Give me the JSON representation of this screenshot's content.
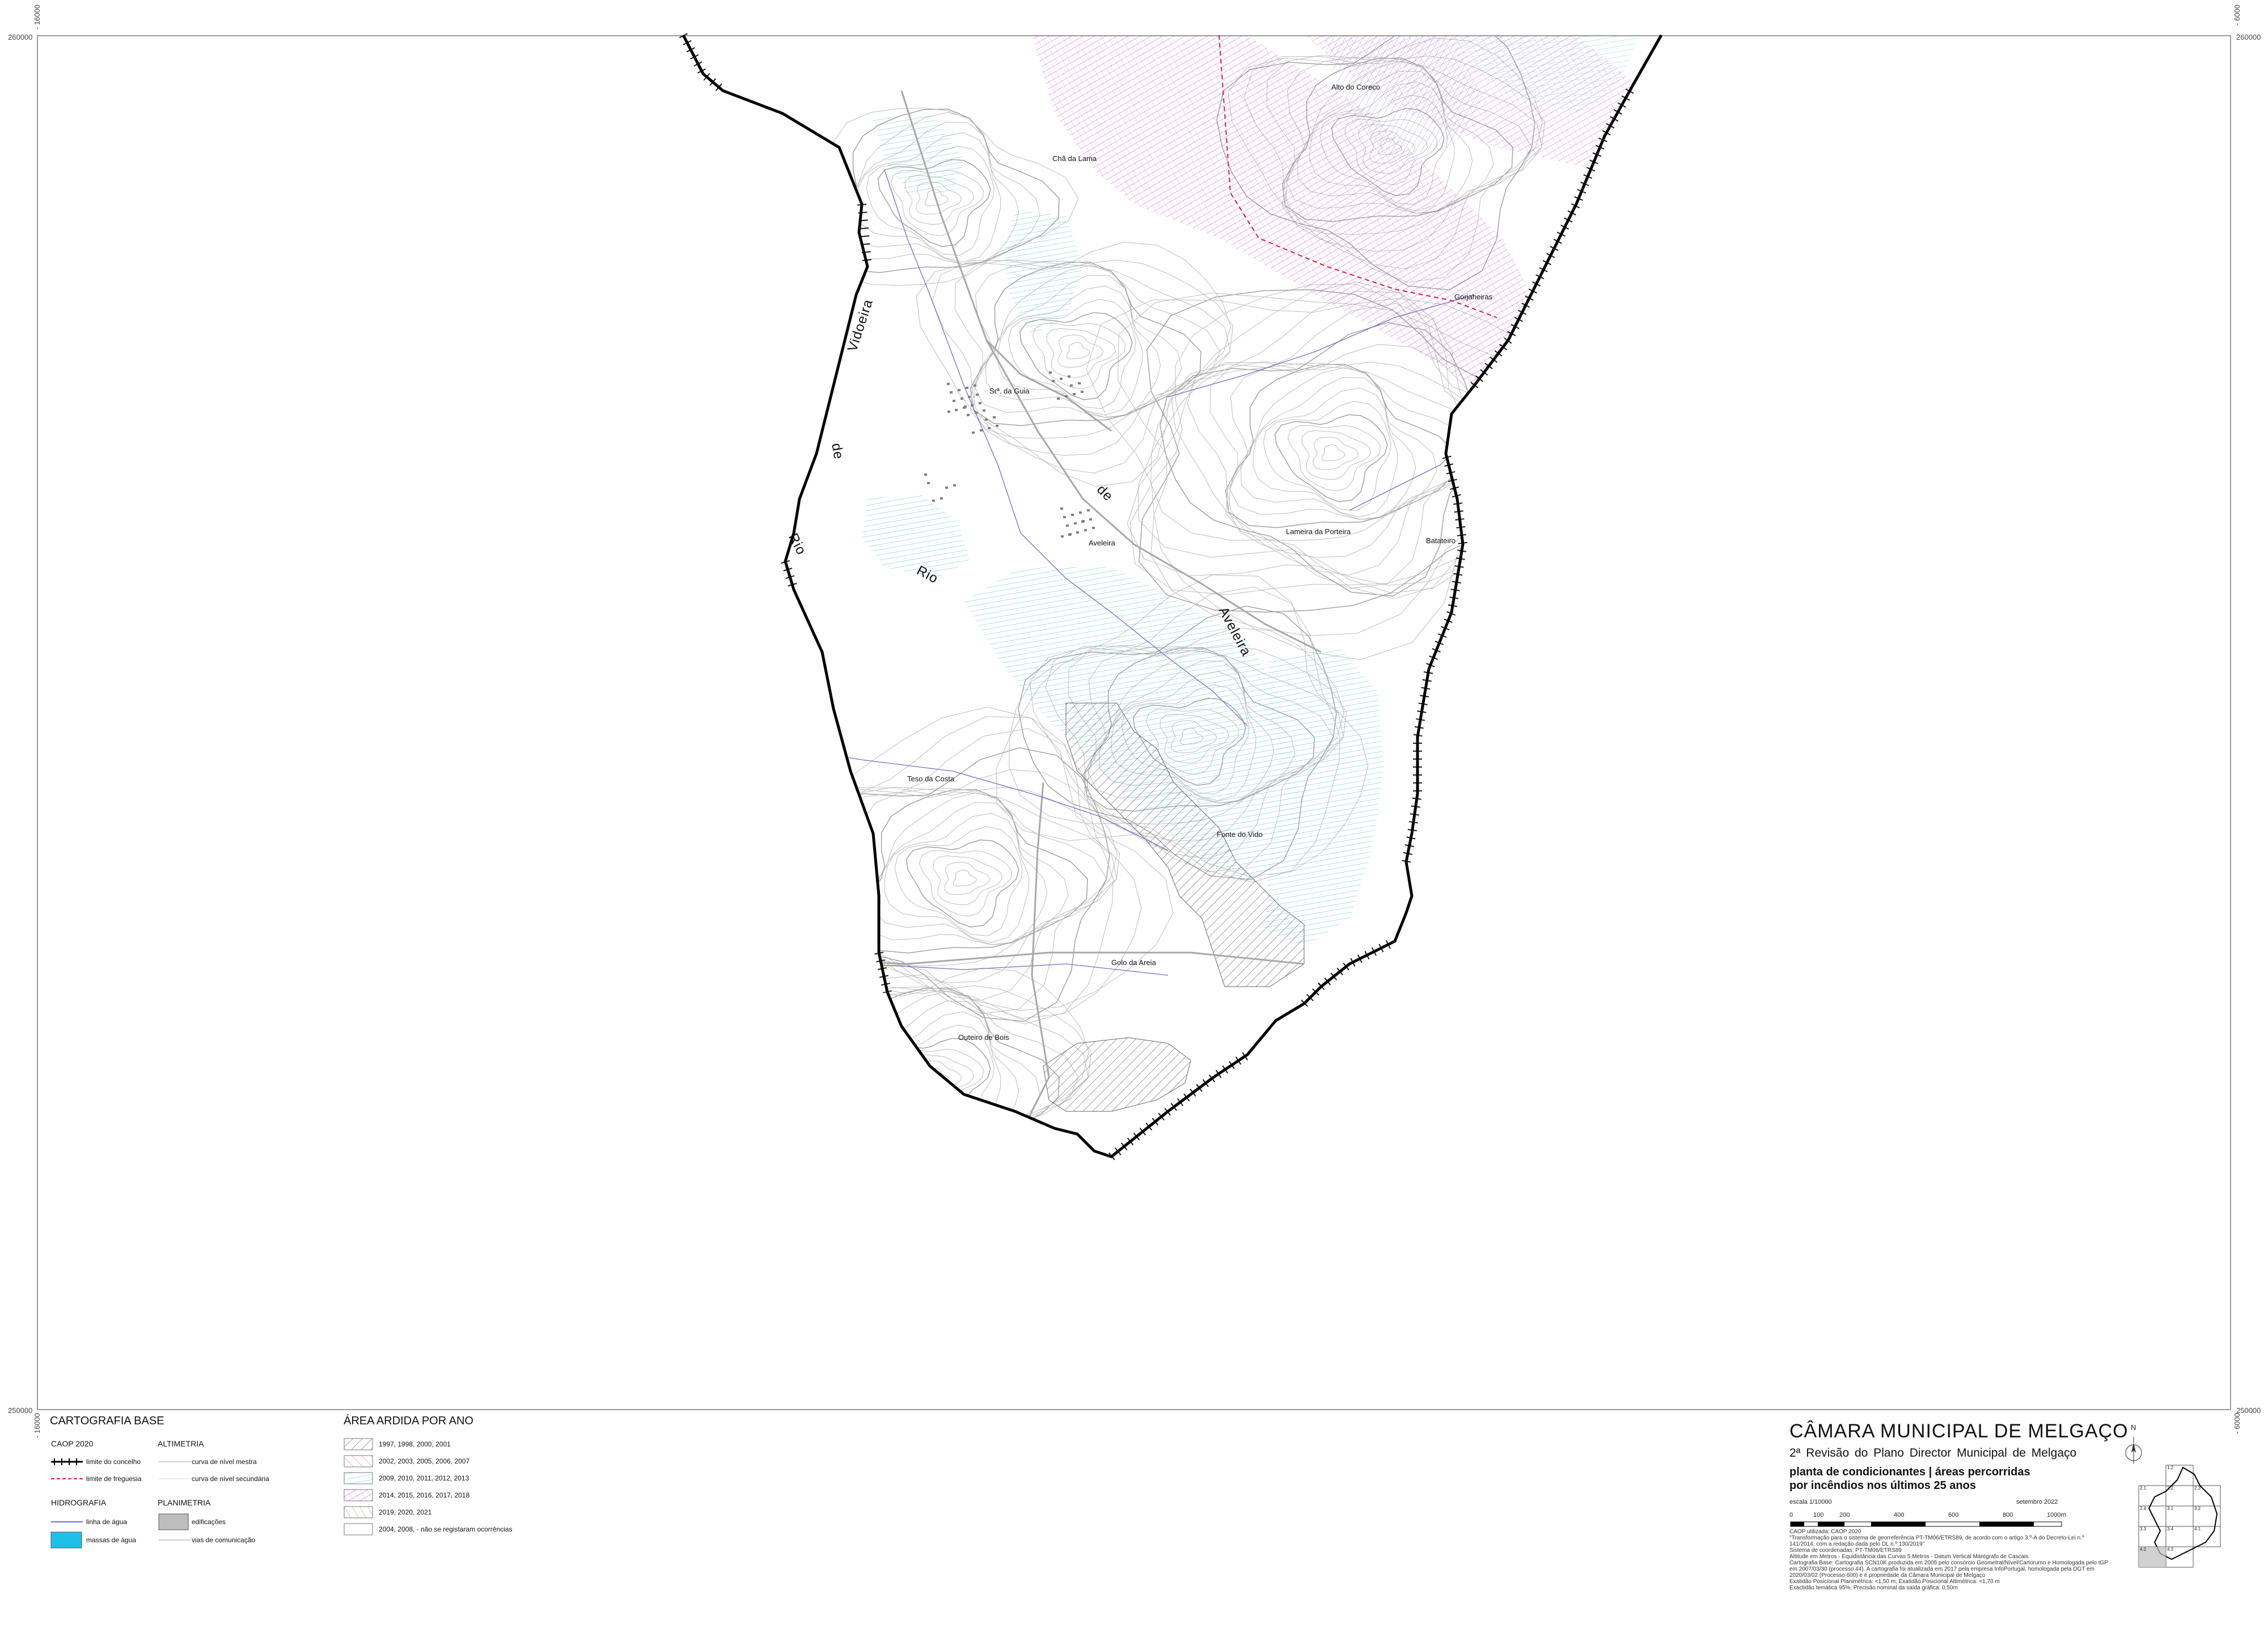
{
  "coordinates": {
    "top_left_y": "260000",
    "top_right_y": "260000",
    "bottom_left_y": "250000",
    "bottom_right_y": "250000",
    "left_x_top": "- 16000",
    "left_x_bottom": "- 16000",
    "right_x_top": "- 6000",
    "right_x_bottom": "- 6000"
  },
  "map": {
    "place_names": {
      "alto_do_coreco": "Alto do Coreco",
      "cha_da_lama": "Chã da Lama",
      "gorjaheiras": "Gorjaheiras",
      "sra_da_guia": "Srª. da Guia",
      "aveleira_village": "Aveleira",
      "lameira": "Lameira da Porteira",
      "batateiro": "Batateiro",
      "teso_da_costa": "Teso da Costa",
      "fonte_do_vido": "Fonte do Vido",
      "golo_da_areia": "Golo da Areia",
      "outeiro_de_bois": "Outeiro de Bois"
    },
    "river_labels": {
      "vidoeira": "Vidoeira",
      "de_1": "de",
      "rio_1": "Rio",
      "rio_2": "Rio",
      "de_2": "de",
      "aveleira": "Aveleira"
    },
    "colors": {
      "boundary": "#000000",
      "parish_limit": "#d21f3c",
      "contour": "#bdbdbd",
      "water_line": "#6f6fc8",
      "roads": "#a8a8a8",
      "hatch_1997_2001": "#777777",
      "hatch_2002_2007": "#e07070",
      "hatch_2009_2013": "#5cc8c0",
      "hatch_2014_2018": "#c050c8",
      "hatch_2019_2021": "#60b050"
    }
  },
  "legend_base": {
    "title": "CARTOGRAFIA BASE",
    "caop": "CAOP 2020",
    "altimetria": "ALTIMETRIA",
    "limite_concelho": "limite do concelho",
    "limite_freguesia": "limite de freguesia",
    "curva_mestra": "curva de nível mestra",
    "curva_secundaria": "curva de nível secundária",
    "hidrografia": "HIDROGRAFIA",
    "planimetria": "PLANIMETRIA",
    "linha_agua": "linha de água",
    "massas_agua": "massas de água",
    "edificacoes": "edificações",
    "vias": "vias de comunicação"
  },
  "legend_burned": {
    "title": "ÁREA ARDIDA POR ANO",
    "items": [
      "1997, 1998, 2000, 2001",
      "2002, 2003, 2005, 2006, 2007",
      "2009, 2010, 2011, 2012, 2013",
      "2014, 2015, 2016, 2017, 2018",
      "2019, 2020, 2021",
      "2004, 2008, - não se registaram ocorrências"
    ]
  },
  "title_block": {
    "institution": "CÂMARA MUNICIPAL DE MELGAÇO",
    "revision": "2ª Revisão do Plano Director Municipal de Melgaço",
    "plan_line1": "planta de condicionantes | áreas percorridas",
    "plan_line2": "por incêndios nos últimos 25 anos",
    "scale_label": "escala 1/10000",
    "date": "setembro 2022",
    "scale_ticks": [
      "0",
      "100",
      "200",
      "400",
      "600",
      "800",
      "1000m"
    ],
    "north": "N",
    "notes": [
      "CAOP utilizada: CAOP 2020",
      "\"Transformação para o sistema de georreferência PT-TM06/ETRS89, de acordo com o artigo 3.º-A do Decreto-Lei n.º",
      "141/2014, com a redação dada pelo DL n.º 130/2019\"",
      "Sistema de coordenadas: PT-TM06/ETRS89",
      "Altitude em Metros - Equidistância das Curvas 5 Metros - Datum Vertical Marégrafo de Cascais",
      "Cartografia Base: Cartografia SCN10K produzida em 2005 pelo consórcio Geometral/Nível/Cartorumo e Homologada pelo IGP",
      "em 2007/03/30 (processo 44). A cartografia foi atualizada em 2017 pela empresa InfoPortugal, homologada pela DGT em",
      "2020/03/02 (Processo 600) e é propriedade da Câmara Municipal de Melgaço",
      "Exatidão Posicional Planimétrica: <1,50 m; Exatidão Posicional Altimétrica: <1,70 m",
      "Exactidão temática 95%; Precisão nominal da saída gráfica: 0,50m"
    ]
  },
  "index_map": {
    "sheets": [
      "1.2",
      "2.1",
      "2.2",
      "2.3",
      "2.4",
      "3.1",
      "3.2",
      "3.3",
      "3.4",
      "4.1",
      "4.2",
      "4.3"
    ]
  }
}
